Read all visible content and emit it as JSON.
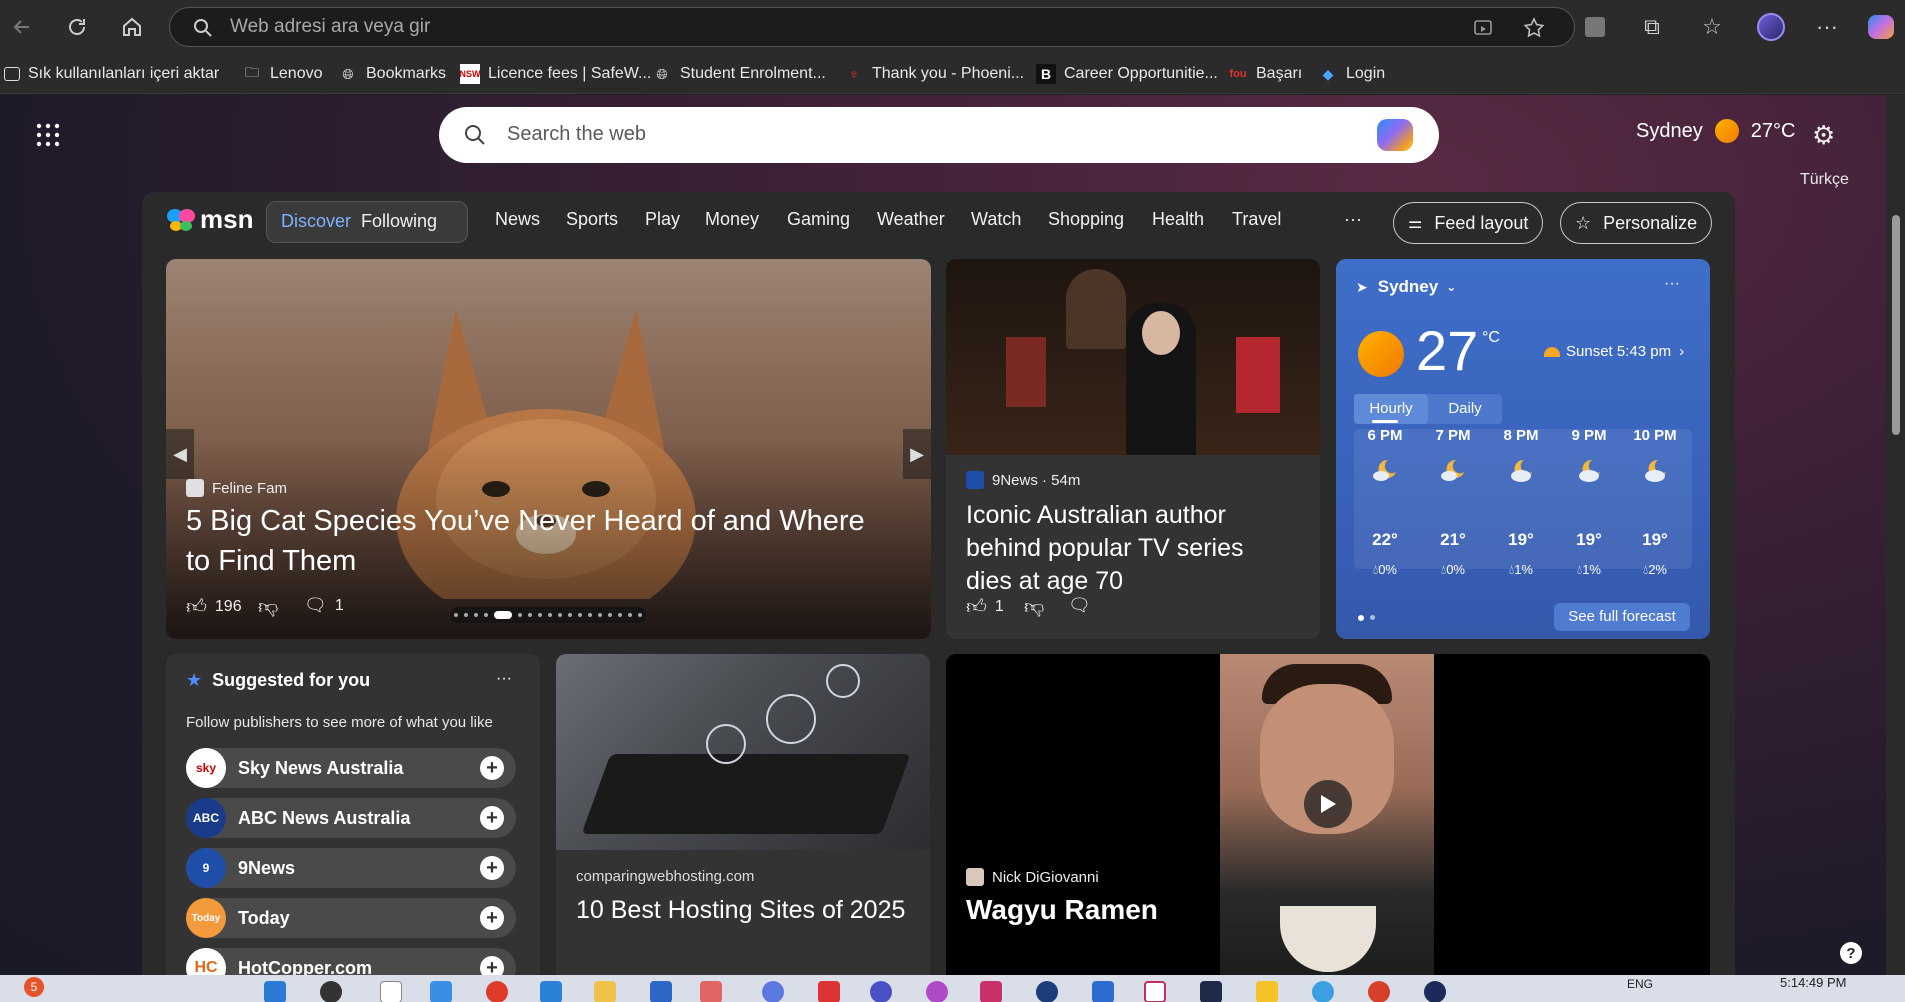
{
  "browser": {
    "address_placeholder": "Web adresi ara veya gir",
    "bookmarks": [
      {
        "label": "Sık kullanılanları içeri aktar",
        "icon": "import-icon"
      },
      {
        "label": "Lenovo",
        "icon": "folder-icon"
      },
      {
        "label": "Bookmarks",
        "icon": "globe-icon"
      },
      {
        "label": "Licence fees | SafeW...",
        "icon": "nsw-icon"
      },
      {
        "label": "Student Enrolment...",
        "icon": "globe-icon"
      },
      {
        "label": "Thank you - Phoeni...",
        "icon": "phoenix-icon"
      },
      {
        "label": "Career Opportunitie...",
        "icon": "b-icon"
      },
      {
        "label": "Başarı",
        "icon": "basari-icon"
      },
      {
        "label": "Login",
        "icon": "login-icon"
      }
    ]
  },
  "msn": {
    "search_placeholder": "Search the web",
    "weather_city": "Sydney",
    "weather_temp": "27°C",
    "language": "Türkçe",
    "logo": "msn",
    "tabs": [
      "Discover",
      "Following"
    ],
    "nav": [
      "News",
      "Sports",
      "Play",
      "Money",
      "Gaming",
      "Weather",
      "Watch",
      "Shopping",
      "Health",
      "Travel"
    ],
    "more": "···",
    "feed_layout": "Feed layout",
    "personalize": "Personalize"
  },
  "hero": {
    "source": "Feline Fam",
    "title_line1": "5 Big Cat Species You’ve Never Heard of and Where",
    "title_line2": "to Find Them",
    "likes": "196",
    "comments": "1"
  },
  "news2": {
    "source": "9News · 54m",
    "title_line1": "Iconic Australian author",
    "title_line2": "behind popular TV series",
    "title_line3": "dies at age 70",
    "likes": "1"
  },
  "weather_card": {
    "city": "Sydney",
    "temp": "27",
    "unit": "°C",
    "sunset": "Sunset 5:43 pm",
    "tab_hourly": "Hourly",
    "tab_daily": "Daily",
    "hours": [
      {
        "time": "6 PM",
        "temp": "22°",
        "precip": "0%"
      },
      {
        "time": "7 PM",
        "temp": "21°",
        "precip": "0%"
      },
      {
        "time": "8 PM",
        "temp": "19°",
        "precip": "1%"
      },
      {
        "time": "9 PM",
        "temp": "19°",
        "precip": "1%"
      },
      {
        "time": "10 PM",
        "temp": "19°",
        "precip": "2%"
      }
    ],
    "see_full": "See full forecast",
    "accent": "#3a64bd"
  },
  "suggested": {
    "title": "Suggested for you",
    "subtitle": "Follow publishers to see more of what you like",
    "publishers": [
      {
        "name": "Sky News Australia",
        "logo": "sky"
      },
      {
        "name": "ABC News Australia",
        "logo": "ABC"
      },
      {
        "name": "9News",
        "logo": "9"
      },
      {
        "name": "Today",
        "logo": "Today"
      },
      {
        "name": "HotCopper.com",
        "logo": "HC"
      }
    ]
  },
  "hosting": {
    "source": "comparingwebhosting.com",
    "title": "10 Best Hosting Sites of 2025"
  },
  "video": {
    "source": "Nick DiGiovanni",
    "title": "Wagyu Ramen"
  },
  "taskbar": {
    "lang": "ENG",
    "time": "5:14:49 PM",
    "notif_count": "5"
  }
}
